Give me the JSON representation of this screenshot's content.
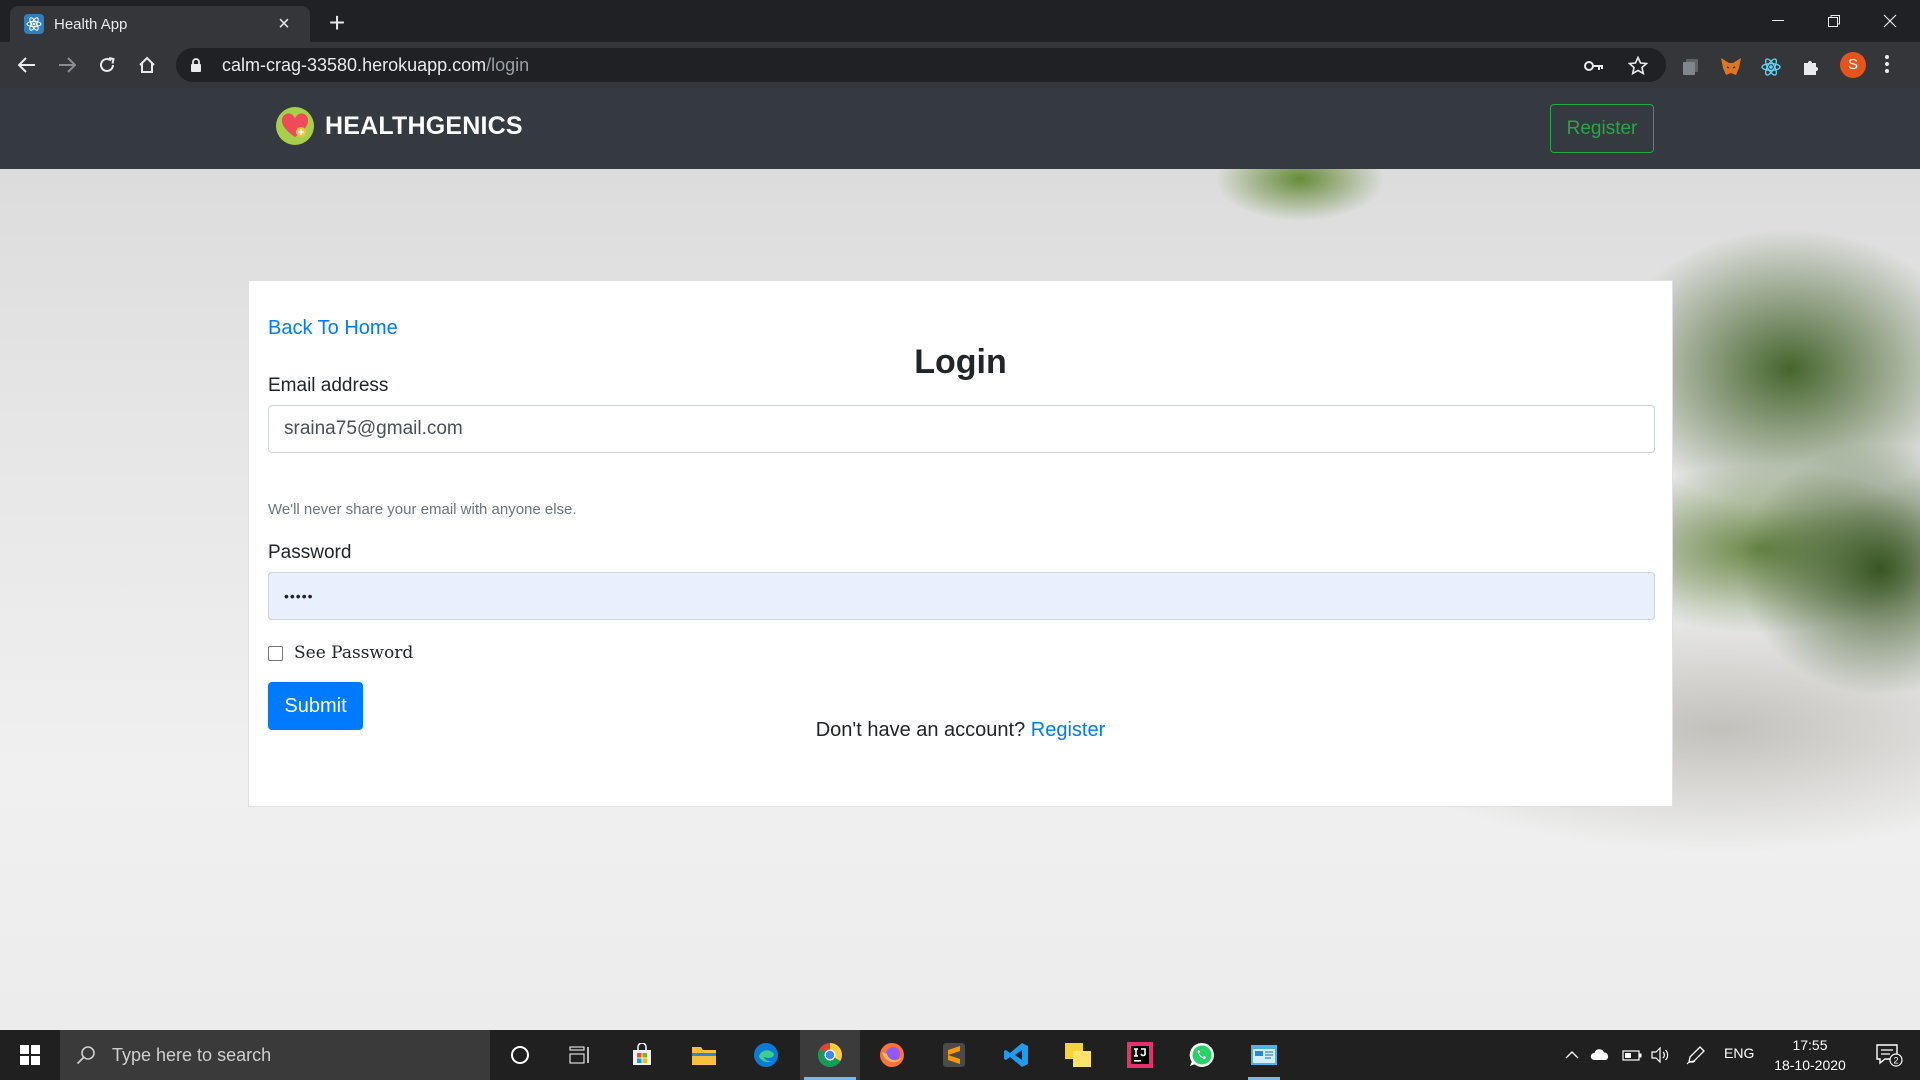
{
  "browser": {
    "tab_title": "Health App",
    "url_host": "calm-crag-33580.herokuapp.com",
    "url_path": "/login",
    "profile_initial": "S"
  },
  "app": {
    "brand": "HEALTHGENICS",
    "nav_register": "Register"
  },
  "login": {
    "back_link": "Back To Home",
    "title": "Login",
    "email_label": "Email address",
    "email_value": "sraina75@gmail.com",
    "email_help": "We'll never share your email with anyone else.",
    "password_label": "Password",
    "password_masked": "•••••",
    "see_password_label": "See Password",
    "submit_label": "Submit",
    "signup_prompt": "Don't have an account?",
    "signup_link": "Register"
  },
  "taskbar": {
    "search_placeholder": "Type here to search",
    "language": "ENG",
    "time": "17:55",
    "date": "18-10-2020",
    "notification_count": "2"
  },
  "colors": {
    "navbar": "#343a40",
    "primary": "#007bff",
    "success": "#28a745",
    "autofill": "#e8f0fe"
  }
}
